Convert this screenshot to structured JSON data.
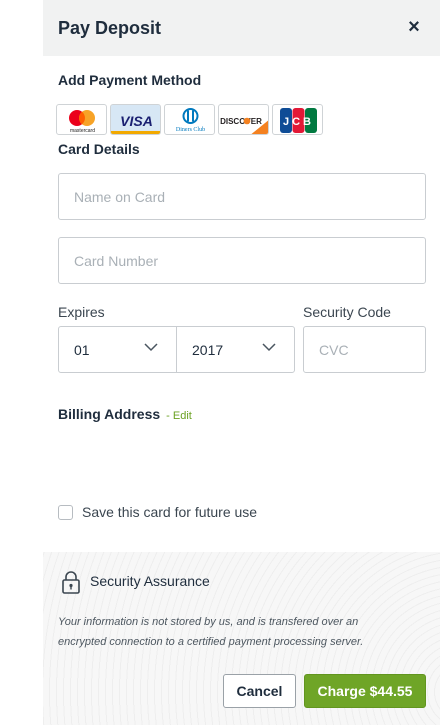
{
  "dialog": {
    "title": "Pay Deposit",
    "close_glyph": "×"
  },
  "payment": {
    "section_label": "Add Payment Method",
    "cards": [
      {
        "name": "mastercard",
        "icon": "mastercard-logo-icon",
        "text": "mastercard"
      },
      {
        "name": "visa",
        "icon": "visa-logo-icon",
        "text": "VISA"
      },
      {
        "name": "diners-club",
        "icon": "diners-club-logo-icon",
        "text": "Diners Club"
      },
      {
        "name": "discover",
        "icon": "discover-logo-icon",
        "text": "DISCOVER"
      },
      {
        "name": "jcb",
        "icon": "jcb-logo-icon",
        "text": "JCB"
      }
    ]
  },
  "card_details": {
    "section_label": "Card Details",
    "name_placeholder": "Name on Card",
    "number_placeholder": "Card Number",
    "expires_label": "Expires",
    "month_value": "01",
    "year_value": "2017",
    "security_label": "Security Code",
    "cvc_placeholder": "CVC"
  },
  "billing": {
    "label": "Billing Address",
    "edit_label": "- Edit"
  },
  "save_card": {
    "label": "Save this card for future use",
    "checked": false
  },
  "assurance": {
    "title": "Security Assurance",
    "text": "Your information is not stored by us, and is transfered over an encrypted connection to a certified payment processing server."
  },
  "actions": {
    "cancel_label": "Cancel",
    "charge_label": "Charge $44.55"
  },
  "colors": {
    "accent": "#6fa527",
    "header_bg": "#f1f2f2",
    "text": "#1f2d3d"
  }
}
